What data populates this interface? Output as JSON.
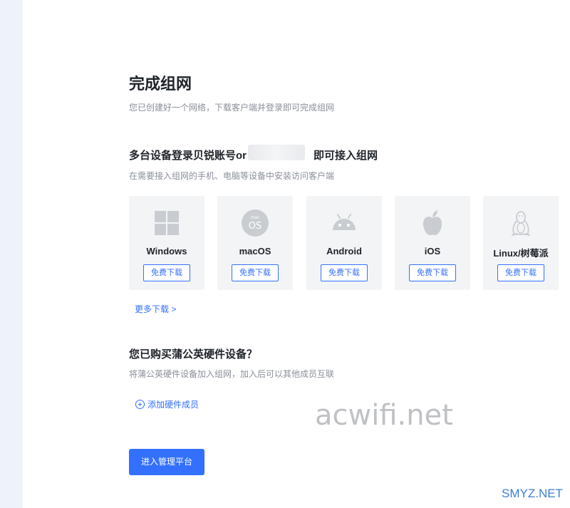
{
  "header": {
    "title": "完成组网",
    "subtitle": "您已创建好一个网络，下载客户端并登录即可完成组网"
  },
  "multi_device": {
    "title_prefix": "多台设备登录贝锐账号or",
    "title_suffix": "即可接入组网",
    "desc": "在需要接入组网的手机、电脑等设备中安装访问客户端"
  },
  "platforms": [
    {
      "name": "Windows",
      "icon": "windows-icon",
      "button": "免费下载"
    },
    {
      "name": "macOS",
      "icon": "macos-icon",
      "button": "免费下载"
    },
    {
      "name": "Android",
      "icon": "android-icon",
      "button": "免费下载"
    },
    {
      "name": "iOS",
      "icon": "apple-icon",
      "button": "免费下载"
    },
    {
      "name": "Linux/树莓派",
      "icon": "linux-icon",
      "button": "免费下载"
    }
  ],
  "more_downloads": "更多下载 >",
  "hardware": {
    "title": "您已购买蒲公英硬件设备？",
    "desc": "将蒲公英硬件设备加入组网，加入后可以其他成员互联",
    "add_label": "添加硬件成员"
  },
  "enter_button": "进入管理平台",
  "watermarks": {
    "center": "acwifi.net",
    "corner": "SMYZ.NET"
  },
  "colors": {
    "accent": "#3370ff",
    "card_bg": "#f3f4f6",
    "icon_gray": "#c9ccd1"
  }
}
